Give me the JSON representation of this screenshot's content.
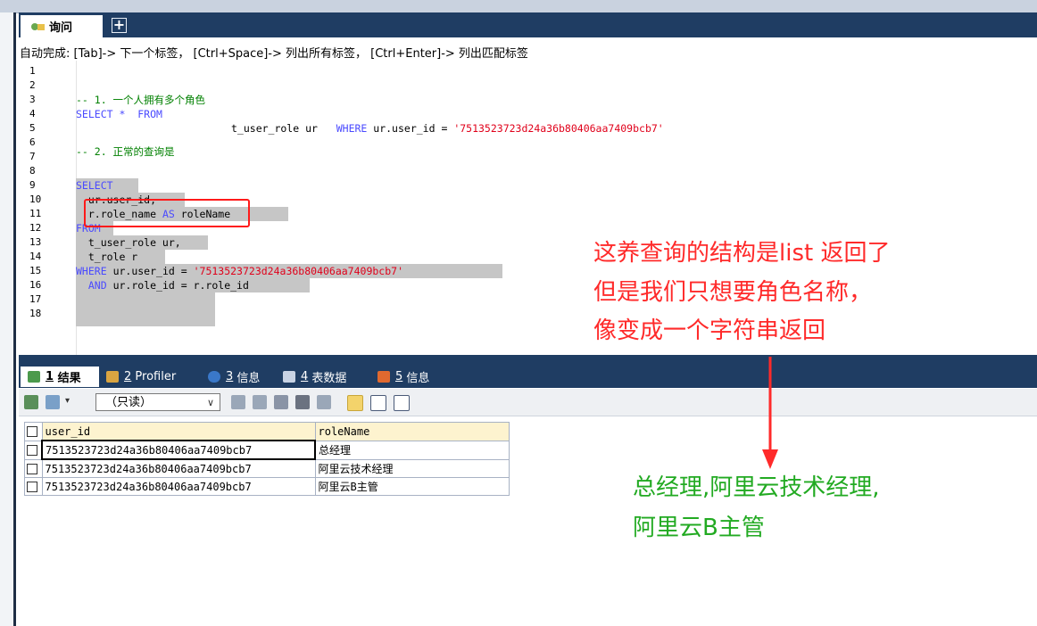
{
  "tabs": {
    "query_label": "询问",
    "add_label": "+"
  },
  "autocomplete_hint": "自动完成: [Tab]-> 下一个标签， [Ctrl+Space]-> 列出所有标签， [Ctrl+Enter]-> 列出匹配标签",
  "editor": {
    "line_numbers": [
      "1",
      "2",
      "3",
      "4",
      "5",
      "6",
      "7",
      "8",
      "9",
      "10",
      "11",
      "12",
      "13",
      "14",
      "15",
      "16",
      "17",
      "18"
    ],
    "line3": "-- 1. 一个人拥有多个角色",
    "line4_kw": "SELECT *  FROM",
    "line5_table": "t_user_role ur",
    "line5_where": "WHERE",
    "line5_cond": "ur.user_id =",
    "line5_str": "'7513523723d24a36b80406aa7409bcb7'",
    "line6": "-- 2. 正常的查询是",
    "line8": "SELECT",
    "line9": "  ur.user_id,",
    "line10_a": "  r.role_name",
    "line10_as": "AS",
    "line10_b": "roleName",
    "line11": "FROM",
    "line12": "  t_user_role ur,",
    "line13": "  t_role r",
    "line14_kw": "WHERE",
    "line14_cond": "ur.user_id =",
    "line14_str": "'7513523723d24a36b80406aa7409bcb7'",
    "line15_kw": "AND",
    "line15_cond": "ur.role_id = r.role_id"
  },
  "result_tabs": [
    {
      "num": "1",
      "label": "结果"
    },
    {
      "num": "2",
      "label": "Profiler"
    },
    {
      "num": "3",
      "label": "信息"
    },
    {
      "num": "4",
      "label": "表数据"
    },
    {
      "num": "5",
      "label": "信息"
    }
  ],
  "toolbar": {
    "readonly_label": "（只读）"
  },
  "grid": {
    "columns": [
      "user_id",
      "roleName"
    ],
    "rows": [
      [
        "7513523723d24a36b80406aa7409bcb7",
        "总经理"
      ],
      [
        "7513523723d24a36b80406aa7409bcb7",
        "阿里云技术经理"
      ],
      [
        "7513523723d24a36b80406aa7409bcb7",
        "阿里云B主管"
      ]
    ]
  },
  "annotations": {
    "red_lines": [
      "这养查询的结构是list 返回了",
      " 但是我们只想要角色名称，",
      "像变成一个字符串返回"
    ],
    "green_lines": [
      "总经理,阿里云技术经理,",
      "阿里云B主管"
    ]
  },
  "colors": {
    "red_note": "#ff2a2a",
    "green_note": "#22aa22",
    "dark_bar": "#1f3d63"
  }
}
